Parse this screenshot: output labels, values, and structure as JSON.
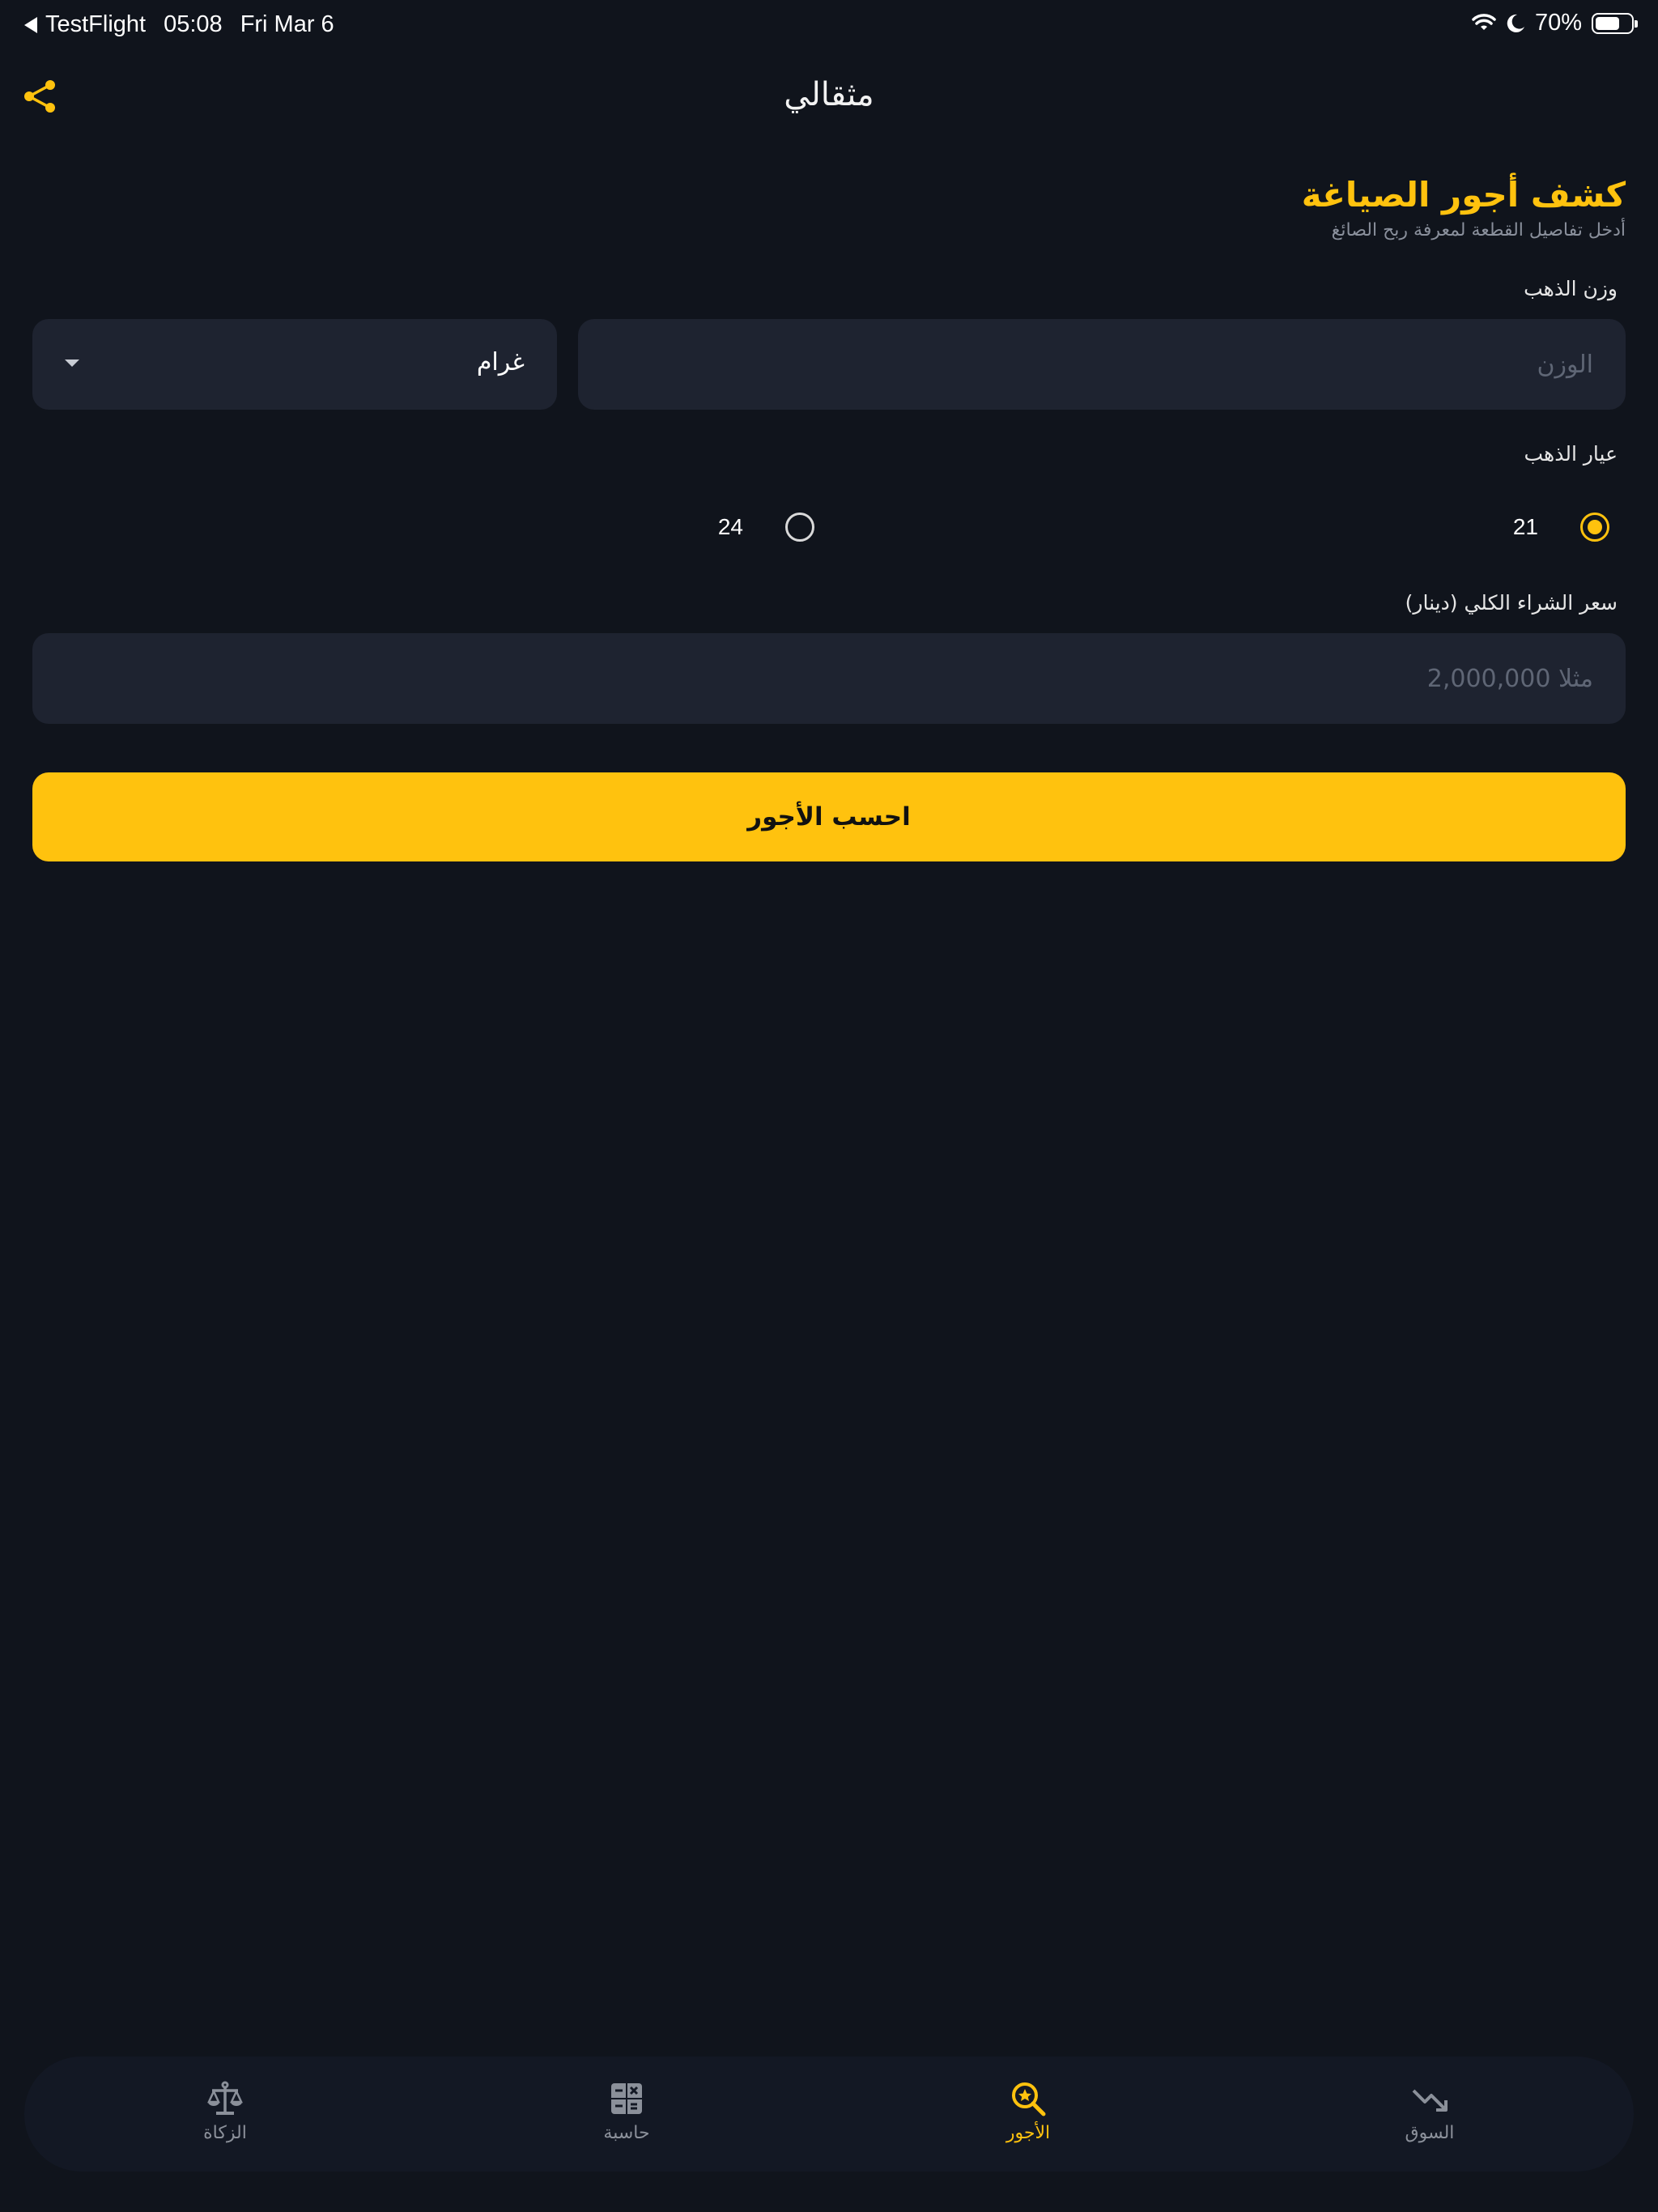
{
  "status_bar": {
    "back_app": "TestFlight",
    "time": "05:08",
    "date": "Fri Mar 6",
    "battery": "70%",
    "battery_level": 0.7
  },
  "header": {
    "title": "مثقالي",
    "share_icon": "share-icon"
  },
  "form": {
    "title": "كشف أجور الصياغة",
    "subtitle": "أدخل تفاصيل القطعة لمعرفة ربح الصائغ",
    "weight": {
      "label": "وزن الذهب",
      "placeholder": "الوزن",
      "unit": "غرام"
    },
    "karat": {
      "label": "عيار الذهب",
      "options": [
        "21",
        "24"
      ],
      "selected": "21"
    },
    "price": {
      "label": "سعر الشراء الكلي (دينار)",
      "placeholder": "مثلا 2,000,000"
    },
    "submit_label": "احسب الأجور"
  },
  "nav": {
    "items": [
      {
        "label": "السوق",
        "icon": "trending-down-icon",
        "active": false
      },
      {
        "label": "الأجور",
        "icon": "search-star-icon",
        "active": true
      },
      {
        "label": "حاسبة",
        "icon": "calculator-icon",
        "active": false
      },
      {
        "label": "الزكاة",
        "icon": "scale-icon",
        "active": false
      }
    ]
  },
  "colors": {
    "background": "#10141c",
    "accent": "#ffc20e",
    "input_bg": "#1e2330",
    "nav_bg": "#131824"
  }
}
